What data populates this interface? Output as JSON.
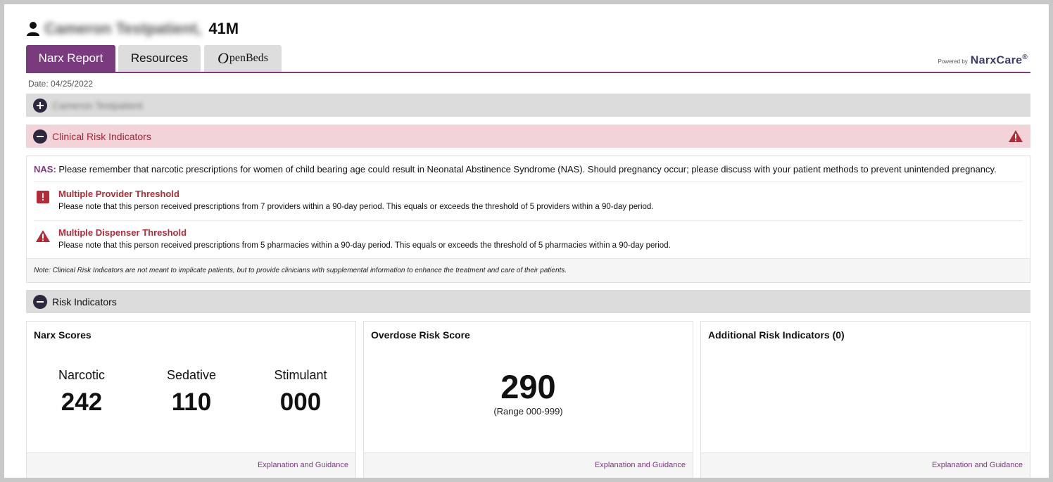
{
  "patient": {
    "name": "Cameron Testpatient,",
    "age_sex": "41M"
  },
  "tabs": [
    {
      "label": "Narx Report",
      "active": true
    },
    {
      "label": "Resources",
      "active": false
    },
    {
      "label": "penBeds",
      "prefix": "O",
      "active": false
    }
  ],
  "branding": {
    "powered_by": "Powered by",
    "brand": "NarxCare",
    "reg": "®"
  },
  "report": {
    "date": "Date: 04/25/2022"
  },
  "sections": {
    "patient_bar": {
      "title": "Cameron Testpatient",
      "expanded": false
    },
    "clinical": {
      "title": "Clinical Risk Indicators",
      "expanded": true
    },
    "risk": {
      "title": "Risk Indicators",
      "expanded": true
    }
  },
  "clinical_risk": {
    "nas_label": "NAS:",
    "nas_text": "Please remember that narcotic prescriptions for women of child bearing age could result in Neonatal Abstinence Syndrome (NAS). Should pregnancy occur; please discuss with your patient methods to prevent unintended pregnancy.",
    "indicators": [
      {
        "icon": "alert-square-icon",
        "title": "Multiple Provider Threshold",
        "text": "Please note that this person received prescriptions from 7 providers within a 90-day period. This equals or exceeds the threshold of 5 providers within a 90-day period."
      },
      {
        "icon": "warning-triangle-icon",
        "title": "Multiple Dispenser Threshold",
        "text": "Please note that this person received prescriptions from 5 pharmacies within a 90-day period. This equals or exceeds the threshold of 5 pharmacies within a 90-day period."
      }
    ],
    "note": "Note: Clinical Risk Indicators are not meant to implicate patients, but to provide clinicians with supplemental information to enhance the treatment and care of their patients."
  },
  "cards": {
    "narx": {
      "title": "Narx Scores",
      "scores": [
        {
          "label": "Narcotic",
          "value": "242"
        },
        {
          "label": "Sedative",
          "value": "110"
        },
        {
          "label": "Stimulant",
          "value": "000"
        }
      ],
      "link": "Explanation and Guidance"
    },
    "overdose": {
      "title": "Overdose Risk Score",
      "value": "290",
      "range": "(Range 000-999)",
      "link": "Explanation and Guidance"
    },
    "additional": {
      "title": "Additional Risk Indicators (0)",
      "link": "Explanation and Guidance"
    }
  },
  "colors": {
    "accent": "#7a3a7e",
    "alert": "#b42a37",
    "alert_bg": "#f2d4d8",
    "bar_bg": "#dcdcdc"
  }
}
